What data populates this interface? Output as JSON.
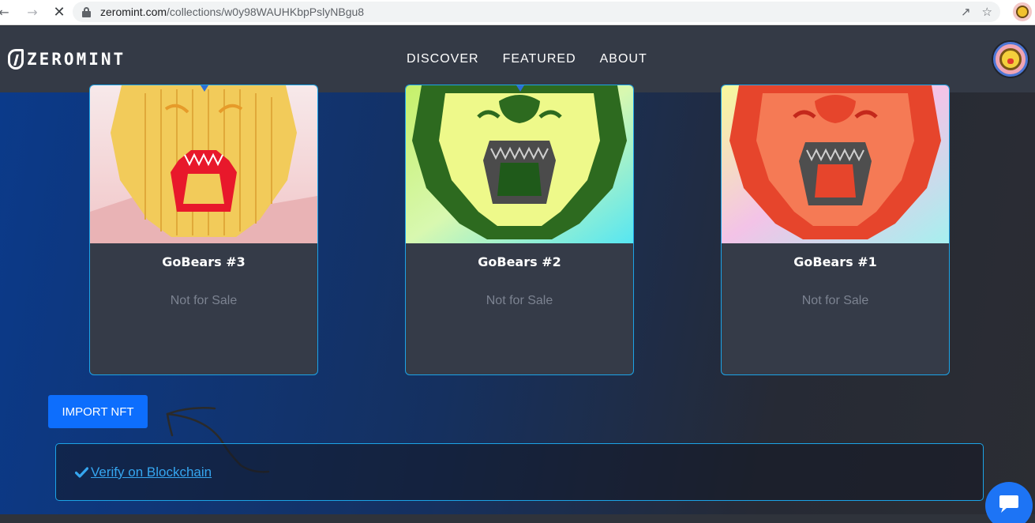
{
  "browser": {
    "url_domain": "zeromint.com",
    "url_path": "/collections/w0y98WAUHKbpPslyNBgu8"
  },
  "header": {
    "logo_text": "ZEROMINT",
    "nav": [
      "DISCOVER",
      "FEATURED",
      "ABOUT"
    ]
  },
  "cards": [
    {
      "title": "GoBears #3",
      "status": "Not for Sale"
    },
    {
      "title": "GoBears #2",
      "status": "Not for Sale"
    },
    {
      "title": "GoBears #1",
      "status": "Not for Sale"
    }
  ],
  "actions": {
    "import_label": "IMPORT NFT",
    "verify_label": "Verify on Blockchain"
  },
  "colors": {
    "accent": "#0d6efd",
    "link": "#35a6f0",
    "card_border": "#1ca3e6"
  }
}
